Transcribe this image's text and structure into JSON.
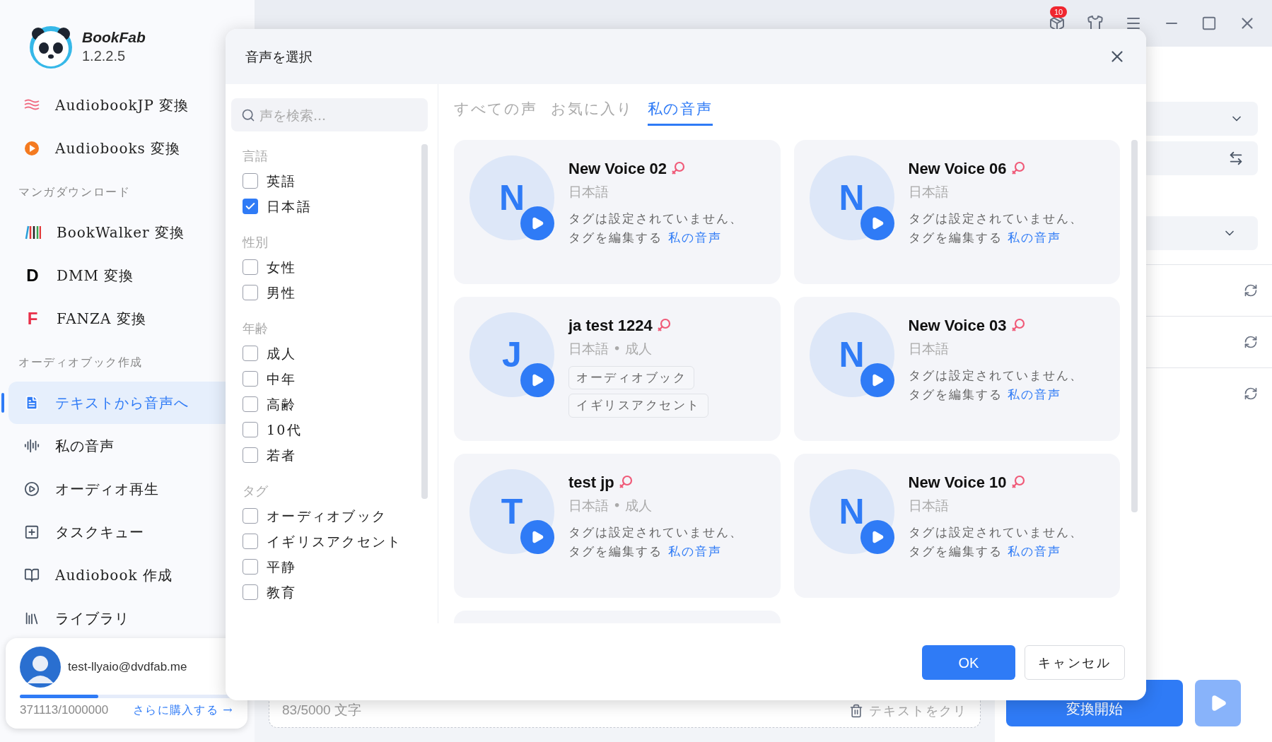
{
  "app": {
    "name": "BookFab",
    "version": "1.2.2.5"
  },
  "sidebar": {
    "items": [
      {
        "kind": "item",
        "label": "AudiobookJP 変換",
        "selected": false
      },
      {
        "kind": "item",
        "label": "Audiobooks 変換",
        "selected": false
      },
      {
        "kind": "section",
        "label": "マンガダウンロード"
      },
      {
        "kind": "item",
        "label": "BookWalker 変換",
        "selected": false
      },
      {
        "kind": "item",
        "letter": "D",
        "label": "DMM 変換",
        "selected": false
      },
      {
        "kind": "item",
        "letter": "F",
        "label": "FANZA 変換",
        "selected": false
      },
      {
        "kind": "section",
        "label": "オーディオブック作成"
      },
      {
        "kind": "item",
        "label": "テキストから音声へ",
        "selected": true
      },
      {
        "kind": "item",
        "label": "私の音声",
        "selected": false
      },
      {
        "kind": "item",
        "label": "オーディオ再生",
        "selected": false
      },
      {
        "kind": "item",
        "label": "タスクキュー",
        "selected": false
      },
      {
        "kind": "item",
        "label": "Audiobook 作成",
        "selected": false
      },
      {
        "kind": "item",
        "label": "ライブラリ",
        "selected": false
      }
    ],
    "account": {
      "email": "test-llyaio@dvdfab.me",
      "level": 0.37,
      "usage": "371113/1000000",
      "buy_link": "さらに購入する →"
    }
  },
  "top_bar": {
    "badge": "10"
  },
  "editor": {
    "char_count": "83/5000 文字",
    "clear_button": "テキストをクリ",
    "convert_button": "変換開始"
  },
  "dialog": {
    "title": "音声を選択",
    "search": {
      "placeholder": "声を検索..."
    },
    "filters": [
      {
        "label": "言語",
        "options": [
          {
            "label": "英語",
            "checked": false
          },
          {
            "label": "日本語",
            "checked": true
          }
        ]
      },
      {
        "label": "性別",
        "options": [
          {
            "label": "女性",
            "checked": false
          },
          {
            "label": "男性",
            "checked": false
          }
        ]
      },
      {
        "label": "年齢",
        "options": [
          {
            "label": "成人",
            "checked": false
          },
          {
            "label": "中年",
            "checked": false
          },
          {
            "label": "高齢",
            "checked": false
          },
          {
            "label": "10代",
            "checked": false
          },
          {
            "label": "若者",
            "checked": false
          }
        ]
      },
      {
        "label": "タグ",
        "options": [
          {
            "label": "オーディオブック",
            "checked": false
          },
          {
            "label": "イギリスアクセント",
            "checked": false
          },
          {
            "label": "平静",
            "checked": false
          },
          {
            "label": "教育",
            "checked": false
          }
        ]
      }
    ],
    "tabs": [
      {
        "label": "すべての声",
        "selected": false
      },
      {
        "label": "お気に入り",
        "selected": false
      },
      {
        "label": "私の音声",
        "selected": true
      }
    ],
    "voices": [
      {
        "initial": "N",
        "name": "New Voice 02",
        "kind": "female",
        "meta": "日本語",
        "note": "タグは設定されていません、タグを編集する",
        "note_link": "私の音声"
      },
      {
        "initial": "N",
        "name": "New Voice 06",
        "kind": "female",
        "meta": "日本語",
        "note": "タグは設定されていません、タグを編集する",
        "note_link": "私の音声"
      },
      {
        "initial": "J",
        "name": "ja test 1224",
        "kind": "female",
        "meta": "日本語 • 成人",
        "tags": [
          "オーディオブック",
          "イギリスアクセント"
        ]
      },
      {
        "initial": "N",
        "name": "New Voice 03",
        "kind": "female",
        "meta": "日本語",
        "note": "タグは設定されていません、タグを編集する",
        "note_link": "私の音声"
      },
      {
        "initial": "T",
        "name": "test jp",
        "kind": "female",
        "meta": "日本語 • 成人",
        "note": "タグは設定されていません、タグを編集する",
        "note_link": "私の音声"
      },
      {
        "initial": "N",
        "name": "New Voice 10",
        "kind": "female",
        "meta": "日本語",
        "note": "タグは設定されていません、タグを編集する",
        "note_link": "私の音声"
      }
    ],
    "ok_button": "OK",
    "cancel_button": "キャンセル"
  }
}
